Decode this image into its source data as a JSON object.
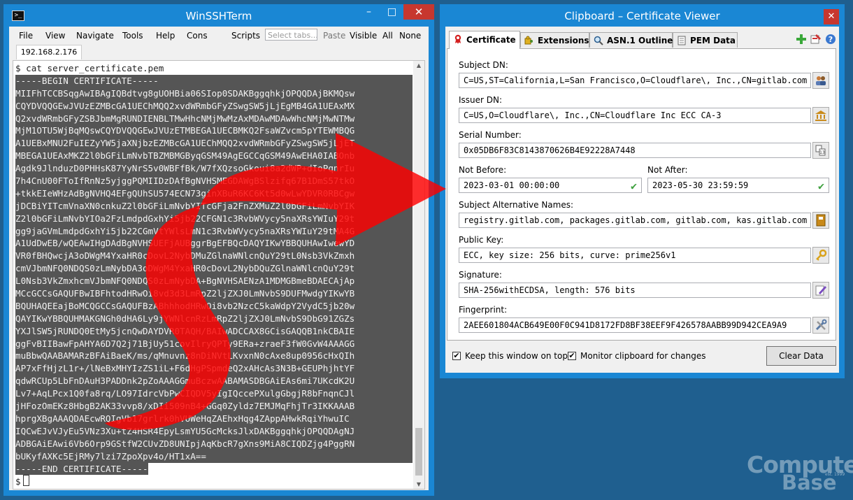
{
  "terminal": {
    "title": "WinSSHTerm",
    "app_icon": "terminal-icon",
    "window_controls": {
      "minimize": "–",
      "maximize": "□",
      "close": "✕"
    },
    "menu": [
      "File",
      "View",
      "Navigate",
      "Tools",
      "Help",
      "Cons"
    ],
    "toolbar": {
      "scripts": "Scripts",
      "select_placeholder": "Select tabs...",
      "paste": "Paste",
      "visible": "Visible",
      "all": "All",
      "none": "None"
    },
    "host_tab": "192.168.2.176",
    "prompt_line": "$ cat server_certificate.pem",
    "cert_lines": [
      "-----BEGIN CERTIFICATE-----",
      "MIIFhTCCBSqgAwIBAgIQBdtvg8gUOHBia06SIop0SDAKBggqhkjOPQQDAjBKMQsw",
      "CQYDVQQGEwJVUzEZMBcGA1UEChMQQ2xvdWRmbGFyZSwgSW5jLjEgMB4GA1UEAxMX",
      "Q2xvdWRmbGFyZSBJbmMgRUNDIENBLTMwHhcNMjMwMzAxMDAwMDAwWhcNMjMwNTMw",
      "MjM1OTU5WjBqMQswCQYDVQQGEwJVUzETMBEGA1UECBMKQ2FsaWZvcm5pYTEWMBQG",
      "A1UEBxMNU2FuIEZyYW5jaXNjbzEZMBcGA1UEChMQQ2xvdWRmbGFyZSwgSW5jLjET",
      "MBEGA1UEAxMKZ2l0bGFiLmNvbTBZMBMGByqGSM49AgEGCCqGSM49AwEHA0IABOnb",
      "Agdk9JlnduzD0PHHsK87YyNrS5v0WBFfBk/W7fXQzsoGkoui8a2dWP+dIoPqnrIu",
      "7h4CnU00FToIfRnNz5yjggPQMIIDzDAfBgNVHSMEGDAWgBSlzifq67B1DmS57tkO",
      "+tkkEIeWHzAdBgNVHQ4EFgQUhSU574ECN73ginXBuR6KC6Kt5d0wLwYDVR0RBCgw",
      "jDCBiYITcmVnaXN0cnkuZ2l0bGFiLmNvbYITcGFja2FnZXMuZ2l0bGFiLmNvbYIK",
      "Z2l0bGFiLmNvbYIOa2FzLmdpdGxhYi5jb22CFGN1c3RvbWVycy5naXRsYWIuY29t",
      "gg9jaGVmLmdpdGxhYi5jb22CGmVtYWlsLmN1c3RvbWVycy5naXRsYWIuY29tMA4G",
      "A1UdDwEB/wQEAwIHgDAdBgNVHSUEFjAUBggrBgEFBQcDAQYIKwYBBQUHAwIwewYD",
      "VR0fBHQwcjA3oDWgM4YxaHR0cDovL2NybDMuZGlnaWNlcnQuY29tL0Nsb3VkZmxh",
      "cmVJbmNFQ0NDQS0zLmNybDA3oDWgM4YxaHR0cDovL2NybDQuZGlnaWNlcnQuY29t",
      "L0Nsb3VkZmxhcmVJbmNFQ0NDQS0zLmNybDA+BgNVHSAENzA1MDMGBmeBDAECAjAp",
      "MCcGCCsGAQUFBwIBFhtodHRwOi8vd3d3LmRpZ2ljZXJ0LmNvbS9DUFMwdgYIKwYB",
      "BQUHAQEEajBoMCQGCCsGAQUFBzABhhhodHRwOi8vb2NzcC5kaWdpY2VydC5jb20w",
      "QAYIKwYBBQUHMAKGNGh0dHA6Ly9jYWNlcnRzLmRpZ2ljZXJ0LmNvbS9DbG91ZGZs",
      "YXJlSW5jRUNDQ0EtMy5jcnQwDAYDVR0TAQH/BAIwADCCAX8GCisGAQQB1nkCBAIE",
      "ggFvBIIBawFpAHYA6D7Q2j71BjUy51covIlryQPTy9ERa+zraeF3fW0GvW4AAAGG",
      "muBbwQAABAMARzBFAiBaeK/ms/qMnuvnz8nDiNVtLKvxnN0cAxe8up0956cHxQIh",
      "AP7xFfHjzL1r+/lNeBxMHYIzZS1iL+F6dHgPSpmdeQ2xAHcAs3N3B+GEUPhjhtYF",
      "qdwRCUp5LbFnDAuH3PADDnk2pZoAAAGGmuBczwAABAMASDBGAiEAs6mi7UKcdK2U",
      "Lv7+AqLPcx1Q0fa8rq/LO97IdrcVbPwCIQDV5yIgIQccePXulgGbgjR8bFnqnCJl",
      "jHFozOmEKz8HbgB2AK33vvp8/xDIi509nB4+GGq0Zyldz7EMJMqFhjTr3IKKAAAB",
      "hprgXBgAAAQDAEcwRQIgVb17grlrk0hVUWeHqZAEhxHqg4ZAppAHwkRqiYhwuIC",
      "IQCwEJvVJyEu5VNz3Xu+tZ4HSR4EpyLsmYU5GcMcksJlxDAKBggqhkjOPQQDAgNJ",
      "ADBGAiEAwi6Vb6Orp9GStfW2CUvZD8UNIpjAqKbcR7gXns9MiA8CIQDZjg4PggRN",
      "bUKyfAXKc5EjRMy7lzi7ZpoXpv4o/HT1xA==",
      "-----END CERTIFICATE-----"
    ],
    "final_prompt": "$"
  },
  "viewer": {
    "title": "Clipboard – Certificate Viewer",
    "close_glyph": "✕",
    "tabs": [
      {
        "label": "Certificate",
        "icon": "ribbon-icon"
      },
      {
        "label": "Extensions",
        "icon": "puzzle-icon"
      },
      {
        "label": "ASN.1 Outline",
        "icon": "magnifier-icon"
      },
      {
        "label": "PEM Data",
        "icon": "document-icon"
      }
    ],
    "toolbar_icons": [
      "add-icon",
      "export-icon",
      "help-icon"
    ],
    "fields": {
      "subject_dn": {
        "label": "Subject DN:",
        "value": "C=US,ST=California,L=San Francisco,O=Cloudflare\\, Inc.,CN=gitlab.com"
      },
      "issuer_dn": {
        "label": "Issuer DN:",
        "value": "C=US,O=Cloudflare\\, Inc.,CN=Cloudflare Inc ECC CA-3"
      },
      "serial": {
        "label": "Serial Number:",
        "value": "0x05DB6F83C8143870626B4E92228A7448"
      },
      "not_before": {
        "label": "Not Before:",
        "value": "2023-03-01 00:00:00"
      },
      "not_after": {
        "label": "Not After:",
        "value": "2023-05-30 23:59:59"
      },
      "san": {
        "label": "Subject Alternative Names:",
        "value": "registry.gitlab.com, packages.gitlab.com, gitlab.com, kas.gitlab.com"
      },
      "public_key": {
        "label": "Public Key:",
        "value": "ECC, key size: 256 bits, curve: prime256v1"
      },
      "signature": {
        "label": "Signature:",
        "value": "SHA-256withECDSA, length: 576 bits"
      },
      "fingerprint": {
        "label": "Fingerprint:",
        "value": "2AEE601804ACB649E00F0C941D8172FD8BF38EEF9F426578AABB99D942CEA9A9"
      }
    },
    "checkmark": "✔",
    "keep_on_top": {
      "label": "Keep this window on top",
      "checked": true
    },
    "monitor_clipboard": {
      "label": "Monitor clipboard for changes",
      "checked": true
    },
    "clear_button": "Clear Data"
  },
  "watermark": {
    "line1": "Computer",
    "line2": "Base",
    "tag": "est. 1999"
  },
  "colors": {
    "desktop": "#1f5f8f",
    "window_frame": "#1a87d4",
    "close_red": "#c7372f",
    "selection": "#555555",
    "arrow_red": "#ff0000"
  }
}
